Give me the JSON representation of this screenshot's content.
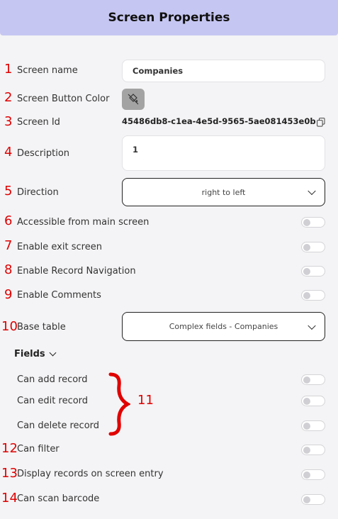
{
  "header": {
    "title": "Screen Properties"
  },
  "numbers": [
    "1",
    "2",
    "3",
    "4",
    "5",
    "6",
    "7",
    "8",
    "9",
    "10",
    "11",
    "12",
    "13",
    "14"
  ],
  "props": {
    "screen_name": {
      "label": "Screen name",
      "value": "Companies"
    },
    "screen_button_color": {
      "label": "Screen Button Color",
      "icon": "no-color-bucket-icon"
    },
    "screen_id": {
      "label": "Screen Id",
      "value": "45486db8-c1ea-4e5d-9565-5ae081453e0b",
      "icon": "copy-icon"
    },
    "description": {
      "label": "Description",
      "value": "1"
    },
    "direction": {
      "label": "Direction",
      "value": "right to left"
    },
    "accessible_main": {
      "label": "Accessible from main screen",
      "on": false
    },
    "enable_exit": {
      "label": "Enable exit screen",
      "on": false
    },
    "enable_record_nav": {
      "label": "Enable Record Navigation",
      "on": false
    },
    "enable_comments": {
      "label": "Enable Comments",
      "on": false
    },
    "base_table": {
      "label": "Base table",
      "value": "Complex fields - Companies"
    }
  },
  "fields": {
    "heading": "Fields",
    "items": [
      {
        "label": "Can add record",
        "on": false
      },
      {
        "label": "Can edit record",
        "on": false
      },
      {
        "label": "Can delete record",
        "on": false
      }
    ]
  },
  "extras": {
    "can_filter": {
      "label": "Can filter",
      "on": false
    },
    "display_records": {
      "label": "Display records on screen entry",
      "on": false
    },
    "can_scan": {
      "label": "Can scan barcode",
      "on": false
    }
  },
  "colors": {
    "header_bg": "#c6c6f2",
    "annotation": "#e00000",
    "page_bg": "#f4f4f6"
  }
}
